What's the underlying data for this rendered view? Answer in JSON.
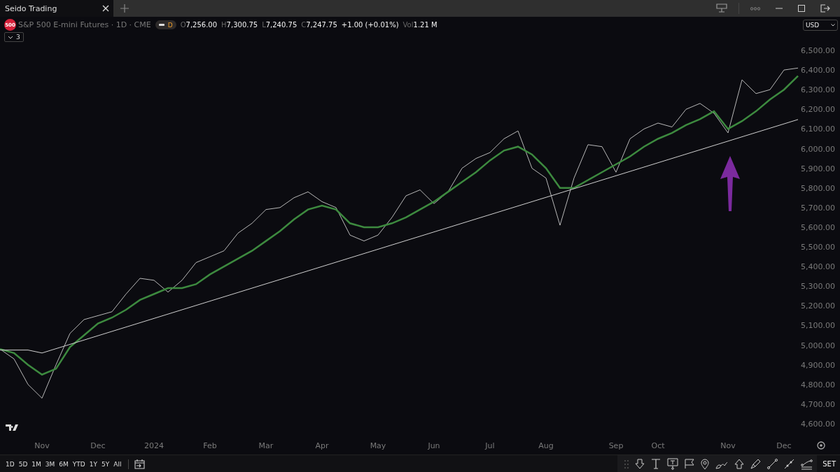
{
  "window": {
    "tabs": [
      {
        "label": "Seido Trading",
        "selected": true
      }
    ]
  },
  "legend": {
    "badge": "500",
    "title": "S&P 500 E-mini Futures · 1D · CME",
    "timeframe_badge": "D",
    "ohlc": [
      {
        "label": "O",
        "value": "7,256.00"
      },
      {
        "label": "H",
        "value": "7,300.75"
      },
      {
        "label": "L",
        "value": "7,240.75"
      },
      {
        "label": "C",
        "value": "7,247.75"
      }
    ],
    "change": "+1.00 (+0.01%)",
    "volume": {
      "label": "Vol",
      "value": "1.21 M"
    },
    "indicator_count": "3"
  },
  "currency": "USD",
  "chart_data": {
    "type": "line",
    "ylim": [
      4600,
      6500
    ],
    "categories": [
      null,
      null,
      null,
      "Nov",
      null,
      null,
      null,
      "Dec",
      null,
      null,
      null,
      "2024",
      null,
      null,
      null,
      "Feb",
      null,
      null,
      null,
      "Mar",
      null,
      null,
      null,
      "Apr",
      null,
      null,
      null,
      "May",
      null,
      null,
      null,
      "Jun",
      null,
      null,
      null,
      "Jul",
      null,
      null,
      null,
      "Aug",
      null,
      null,
      null,
      null,
      "Sep",
      null,
      null,
      "Oct",
      null,
      null,
      null,
      null,
      "Nov",
      null,
      null,
      null,
      "Dec",
      null
    ],
    "yticks": [
      {
        "value": 6500,
        "label": "6,500.00"
      },
      {
        "value": 6400,
        "label": "6,400.00"
      },
      {
        "value": 6300,
        "label": "6,300.00"
      },
      {
        "value": 6200,
        "label": "6,200.00"
      },
      {
        "value": 6100,
        "label": "6,100.00"
      },
      {
        "value": 6000,
        "label": "6,000.00"
      },
      {
        "value": 5900,
        "label": "5,900.00"
      },
      {
        "value": 5800,
        "label": "5,800.00"
      },
      {
        "value": 5700,
        "label": "5,700.00"
      },
      {
        "value": 5600,
        "label": "5,600.00"
      },
      {
        "value": 5500,
        "label": "5,500.00"
      },
      {
        "value": 5400,
        "label": "5,400.00"
      },
      {
        "value": 5300,
        "label": "5,300.00"
      },
      {
        "value": 5200,
        "label": "5,200.00"
      },
      {
        "value": 5100,
        "label": "5,100.00"
      },
      {
        "value": 5000,
        "label": "5,000.00"
      },
      {
        "value": 4900,
        "label": "4,900.00"
      },
      {
        "value": 4800,
        "label": "4,800.00"
      },
      {
        "value": 4700,
        "label": "4,700.00"
      },
      {
        "value": 4600,
        "label": "4,600.00"
      }
    ],
    "series": [
      {
        "color": "#b8b8b8",
        "values": [
          4980,
          4930,
          4800,
          4730,
          4900,
          5060,
          5130,
          5150,
          5170,
          5260,
          5340,
          5330,
          5270,
          5330,
          5420,
          5450,
          5480,
          5570,
          5620,
          5690,
          5700,
          5750,
          5780,
          5730,
          5700,
          5560,
          5530,
          5560,
          5650,
          5760,
          5790,
          5720,
          5780,
          5900,
          5950,
          5980,
          6050,
          6090,
          5900,
          5850,
          5610,
          5850,
          6020,
          6010,
          5880,
          6050,
          6100,
          6130,
          6110,
          6200,
          6230,
          6180,
          6080,
          6350,
          6280,
          6300,
          6400,
          6410
        ]
      },
      {
        "color": "#3d8a3f",
        "values": [
          4980,
          4960,
          4900,
          4850,
          4880,
          4990,
          5050,
          5110,
          5140,
          5180,
          5230,
          5260,
          5290,
          5290,
          5310,
          5360,
          5400,
          5440,
          5480,
          5530,
          5580,
          5640,
          5690,
          5710,
          5690,
          5620,
          5600,
          5600,
          5620,
          5650,
          5690,
          5730,
          5780,
          5830,
          5880,
          5940,
          5990,
          6010,
          5970,
          5900,
          5800,
          5800,
          5840,
          5880,
          5920,
          5960,
          6010,
          6050,
          6080,
          6120,
          6150,
          6190,
          6100,
          6140,
          6190,
          6250,
          6300,
          6370
        ]
      },
      {
        "color": "#d0d0d0",
        "values": [
          4975,
          4975,
          4975,
          4960,
          4982,
          5004,
          5026,
          5048,
          5070,
          5092,
          5114,
          5136,
          5158,
          5180,
          5202,
          5224,
          5246,
          5268,
          5290,
          5312,
          5334,
          5356,
          5378,
          5400,
          5422,
          5444,
          5466,
          5488,
          5510,
          5532,
          5554,
          5576,
          5598,
          5620,
          5642,
          5664,
          5686,
          5708,
          5730,
          5752,
          5774,
          5796,
          5818,
          5840,
          5862,
          5884,
          5906,
          5928,
          5950,
          5972,
          5994,
          6016,
          6038,
          6060,
          6082,
          6104,
          6126,
          6148
        ]
      }
    ]
  },
  "range_buttons": [
    "1D",
    "5D",
    "1M",
    "3M",
    "6M",
    "YTD",
    "1Y",
    "5Y",
    "All"
  ],
  "drawing_toolbar": {
    "label": "SET"
  }
}
